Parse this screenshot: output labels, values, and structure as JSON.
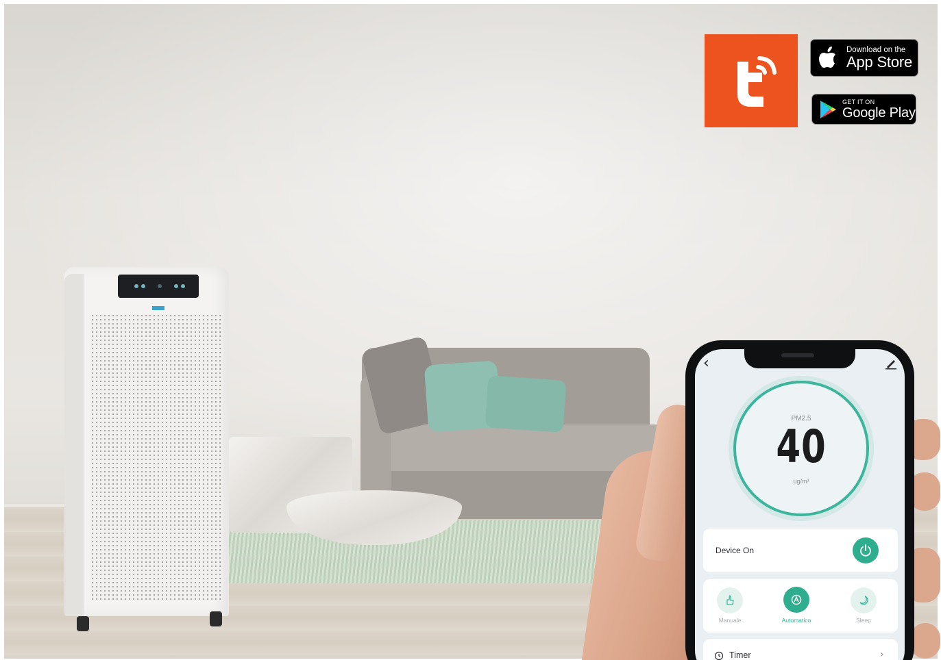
{
  "badges": {
    "apple_line1": "Download on the",
    "apple_line2": "App Store",
    "google_line1": "GET IT ON",
    "google_line2": "Google Play"
  },
  "brand": {
    "tuya_color": "#ec531f",
    "accent_green": "#2fae8f",
    "tuya_icon": "tuya-t-wifi-icon"
  },
  "app": {
    "pm_label": "PM2.5",
    "pm_value": "40",
    "pm_unit": "ug/m³",
    "device_label": "Device On",
    "modes": [
      {
        "label": "Manuale",
        "icon": "hand-icon",
        "active": false
      },
      {
        "label": "Automatico",
        "icon": "auto-mode-icon",
        "active": true
      },
      {
        "label": "Sleep",
        "icon": "moon-icon",
        "active": false
      }
    ],
    "timer_label": "Timer"
  }
}
